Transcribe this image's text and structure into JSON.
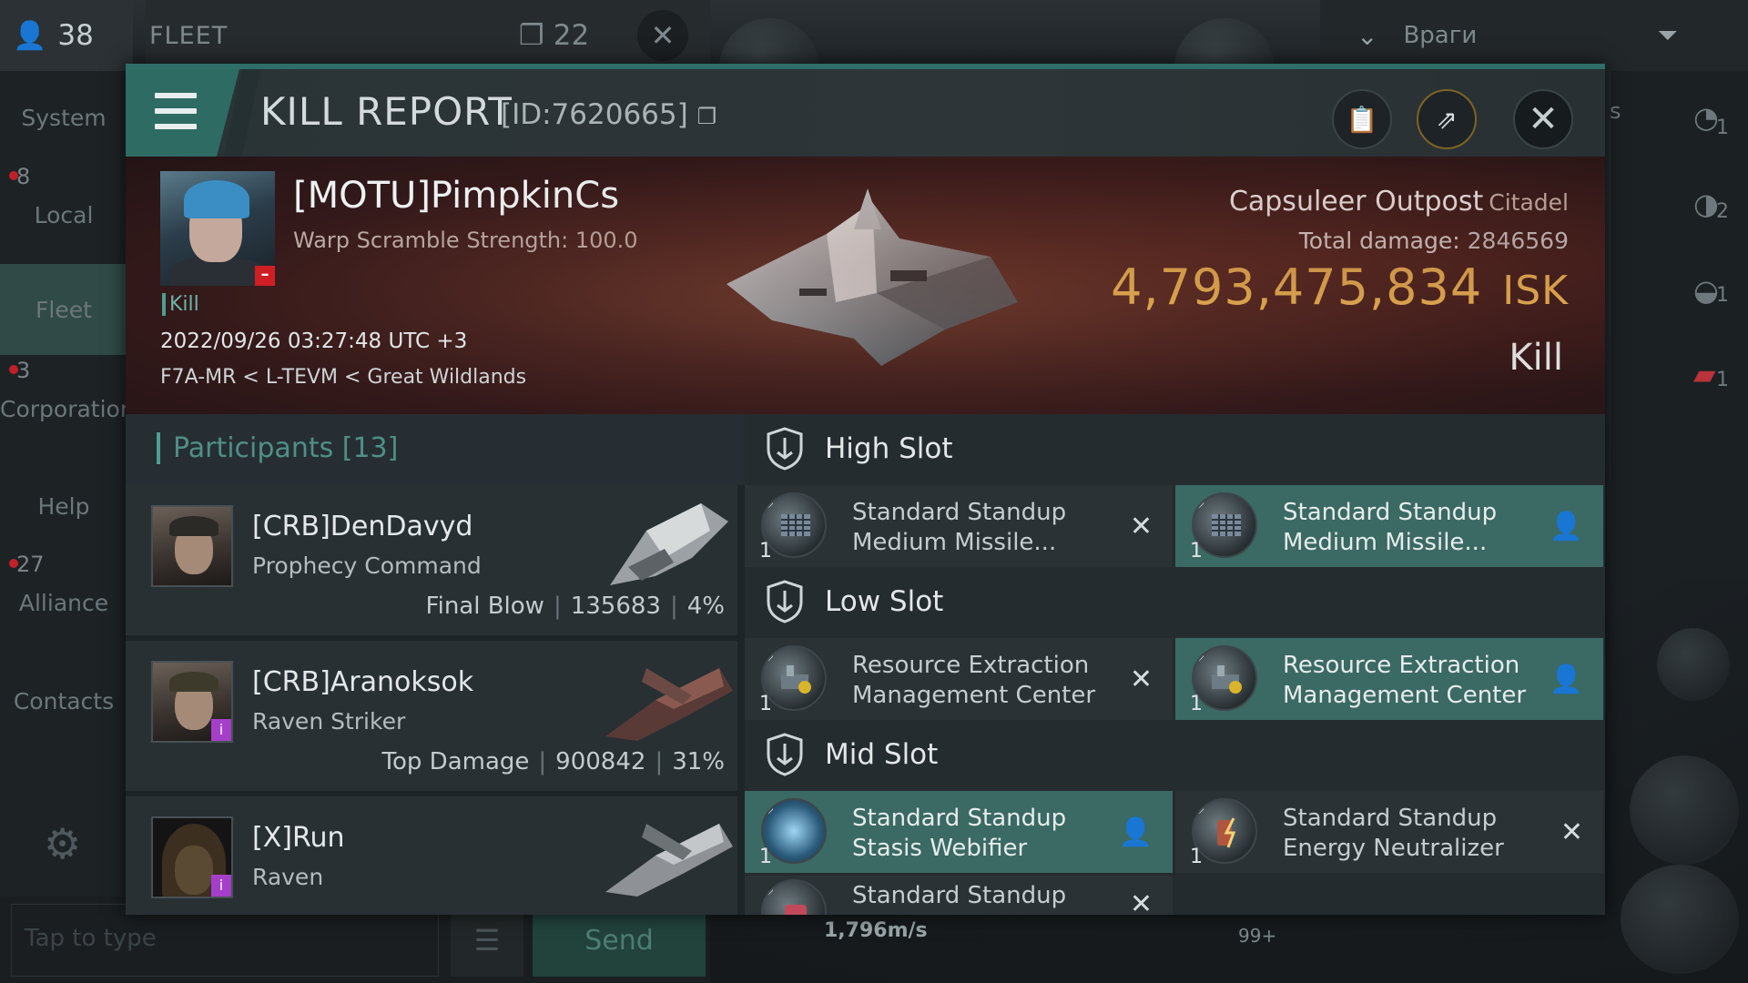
{
  "hud": {
    "pilot_count": "38",
    "fleet_label": "FLEET",
    "fleet_count": "22",
    "enemies_label": "Враги",
    "speed": "1,796m/s",
    "count_badge": "99+"
  },
  "sidebar": {
    "items": [
      {
        "label": "System",
        "count": ""
      },
      {
        "label": "Local",
        "count": "8"
      },
      {
        "label": "Fleet",
        "count": ""
      },
      {
        "label": "Corporation",
        "count": "3"
      },
      {
        "label": "Help",
        "count": ""
      },
      {
        "label": "Alliance",
        "count": "27"
      },
      {
        "label": "Contacts",
        "count": ""
      }
    ]
  },
  "right_panel": {
    "counts": [
      "1",
      "2",
      "1",
      "1"
    ],
    "letter": "s"
  },
  "chat": {
    "placeholder": "Tap to type",
    "send_label": "Send"
  },
  "report": {
    "title": "KILL REPORT",
    "id_label": "[ID:7620665]",
    "victim": {
      "name": "[MOTU]PimpkinCs",
      "warp_scramble": "Warp Scramble Strength: 100.0",
      "tag": "Kill",
      "datetime": "2022/09/26 03:27:48 UTC +3",
      "location": "F7A-MR < L-TEVM < Great Wildlands"
    },
    "structure": {
      "name": "Capsuleer Outpost",
      "class": "Citadel"
    },
    "total_damage_label": "Total damage:",
    "total_damage": "2846569",
    "isk_value": "4,793,475,834",
    "isk_unit": "ISK",
    "result": "Kill",
    "participants_label": "Participants [13]",
    "participants": [
      {
        "name": "[CRB]DenDavyd",
        "ship": "Prophecy Command",
        "role": "Final Blow",
        "damage": "135683",
        "percent": "4%"
      },
      {
        "name": "[CRB]Aranoksok",
        "ship": "Raven Striker",
        "role": "Top Damage",
        "damage": "900842",
        "percent": "31%"
      },
      {
        "name": "[X]Run",
        "ship": "Raven",
        "role": "",
        "damage": "",
        "percent": ""
      }
    ],
    "slots": [
      {
        "title": "High Slot",
        "modules": [
          {
            "name": "Standard Standup\nMedium Missile...",
            "qty": "1",
            "state": "destroyed"
          },
          {
            "name": "Standard Standup\nMedium Missile...",
            "qty": "1",
            "state": "dropped"
          }
        ]
      },
      {
        "title": "Low Slot",
        "modules": [
          {
            "name": "Resource Extraction\nManagement Center",
            "qty": "1",
            "state": "destroyed"
          },
          {
            "name": "Resource Extraction\nManagement Center",
            "qty": "1",
            "state": "dropped"
          }
        ]
      },
      {
        "title": "Mid Slot",
        "modules": [
          {
            "name": "Standard Standup\nStasis Webifier",
            "qty": "1",
            "state": "dropped"
          },
          {
            "name": "Standard Standup\nEnergy Neutralizer",
            "qty": "1",
            "state": "destroyed"
          },
          {
            "name": "Standard Standup",
            "qty": "",
            "state": "destroyed"
          }
        ]
      }
    ]
  },
  "colors": {
    "accent": "#3b6963",
    "isk": "#f3c25a",
    "alert": "#d01e25"
  }
}
